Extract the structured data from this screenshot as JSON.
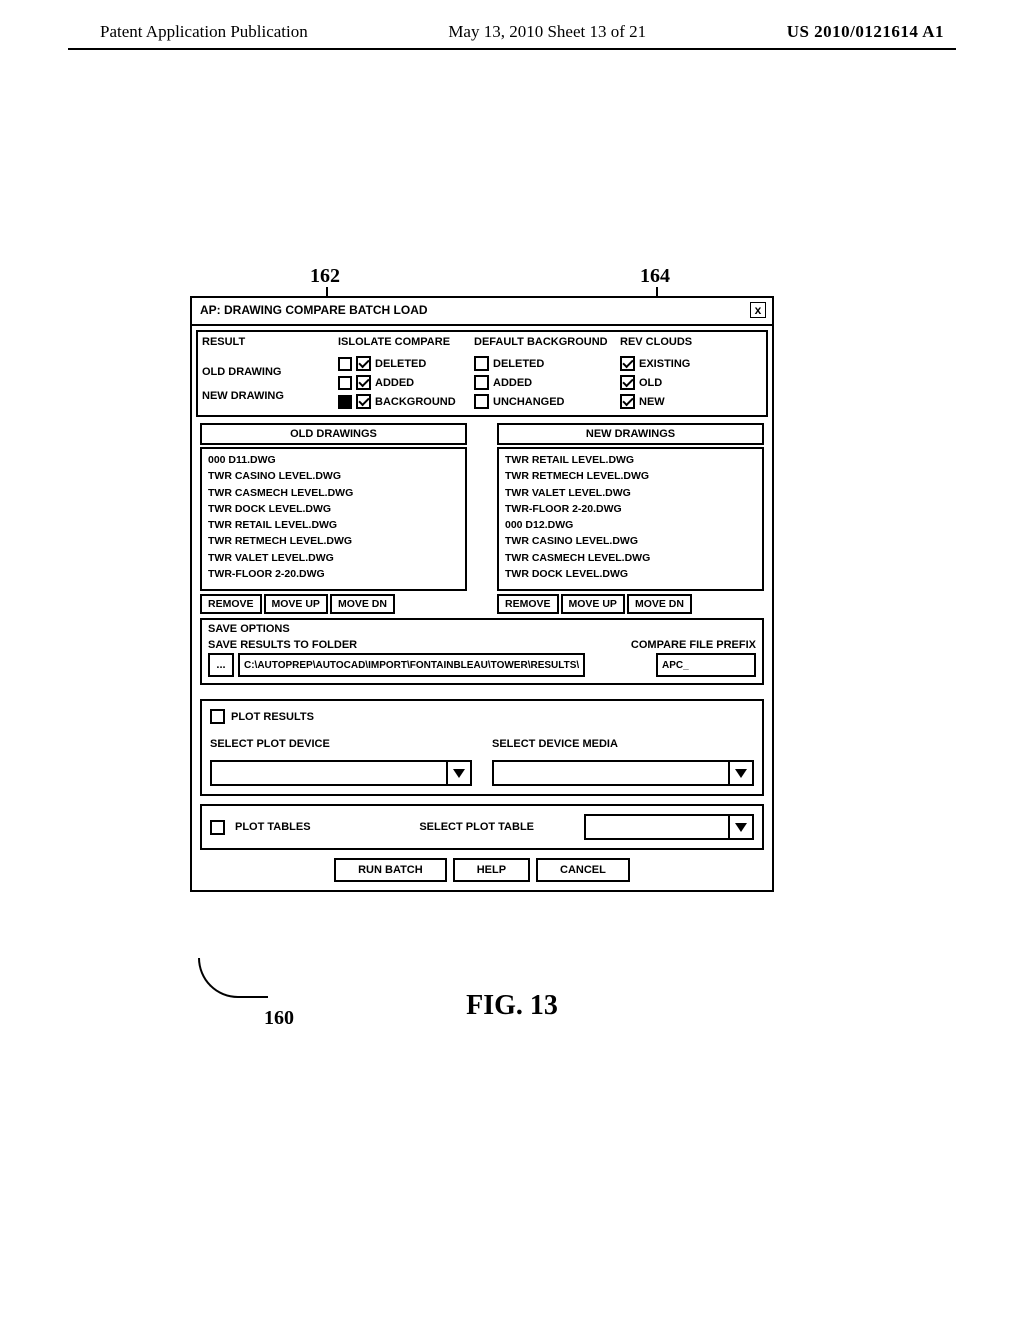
{
  "page_header": {
    "left": "Patent Application Publication",
    "mid": "May 13, 2010   Sheet 13 of 21",
    "right": "US 2010/0121614 A1"
  },
  "callouts": {
    "c162": "162",
    "c164": "164",
    "c160": "160"
  },
  "dialog": {
    "title": "AP: DRAWING COMPARE BATCH LOAD",
    "close": "x",
    "result": {
      "head": "RESULT",
      "old_label": "OLD DRAWING",
      "new_label": "NEW DRAWING"
    },
    "isolate": {
      "head": "ISLOLATE COMPARE",
      "deleted": "DELETED",
      "added": "ADDED",
      "background": "BACKGROUND"
    },
    "defaultbg": {
      "head": "DEFAULT BACKGROUND",
      "deleted": "DELETED",
      "added": "ADDED",
      "unchanged": "UNCHANGED"
    },
    "rev": {
      "head": "REV CLOUDS",
      "existing": "EXISTING",
      "old": "OLD",
      "new": "NEW"
    },
    "old_list": {
      "header": "OLD DRAWINGS",
      "items": [
        "000 D11.DWG",
        "TWR CASINO LEVEL.DWG",
        "TWR CASMECH LEVEL.DWG",
        "TWR DOCK LEVEL.DWG",
        "TWR RETAIL LEVEL.DWG",
        "TWR RETMECH LEVEL.DWG",
        "TWR VALET LEVEL.DWG",
        "TWR-FLOOR 2-20.DWG"
      ]
    },
    "new_list": {
      "header": "NEW DRAWINGS",
      "items": [
        "TWR RETAIL LEVEL.DWG",
        "TWR RETMECH LEVEL.DWG",
        "TWR VALET LEVEL.DWG",
        "TWR-FLOOR 2-20.DWG",
        "000 D12.DWG",
        "TWR CASINO LEVEL.DWG",
        "TWR CASMECH LEVEL.DWG",
        "TWR DOCK LEVEL.DWG"
      ]
    },
    "list_buttons": {
      "remove": "REMOVE",
      "moveup": "MOVE UP",
      "movedn": "MOVE DN"
    },
    "save": {
      "options": "SAVE OPTIONS",
      "to_folder": "SAVE RESULTS TO FOLDER",
      "browse": "...",
      "path": "C:\\AUTOPREP\\AUTOCAD\\IMPORT\\FONTAINBLEAU\\TOWER\\RESULTS\\",
      "prefix_label": "COMPARE FILE PREFIX",
      "prefix": "APC_"
    },
    "plot": {
      "results": "PLOT RESULTS",
      "device_label": "SELECT PLOT DEVICE",
      "media_label": "SELECT DEVICE MEDIA",
      "tables": "PLOT TABLES",
      "table_label": "SELECT PLOT TABLE"
    },
    "buttons": {
      "run": "RUN BATCH",
      "help": "HELP",
      "cancel": "CANCEL"
    }
  },
  "figure_label": "FIG. 13"
}
